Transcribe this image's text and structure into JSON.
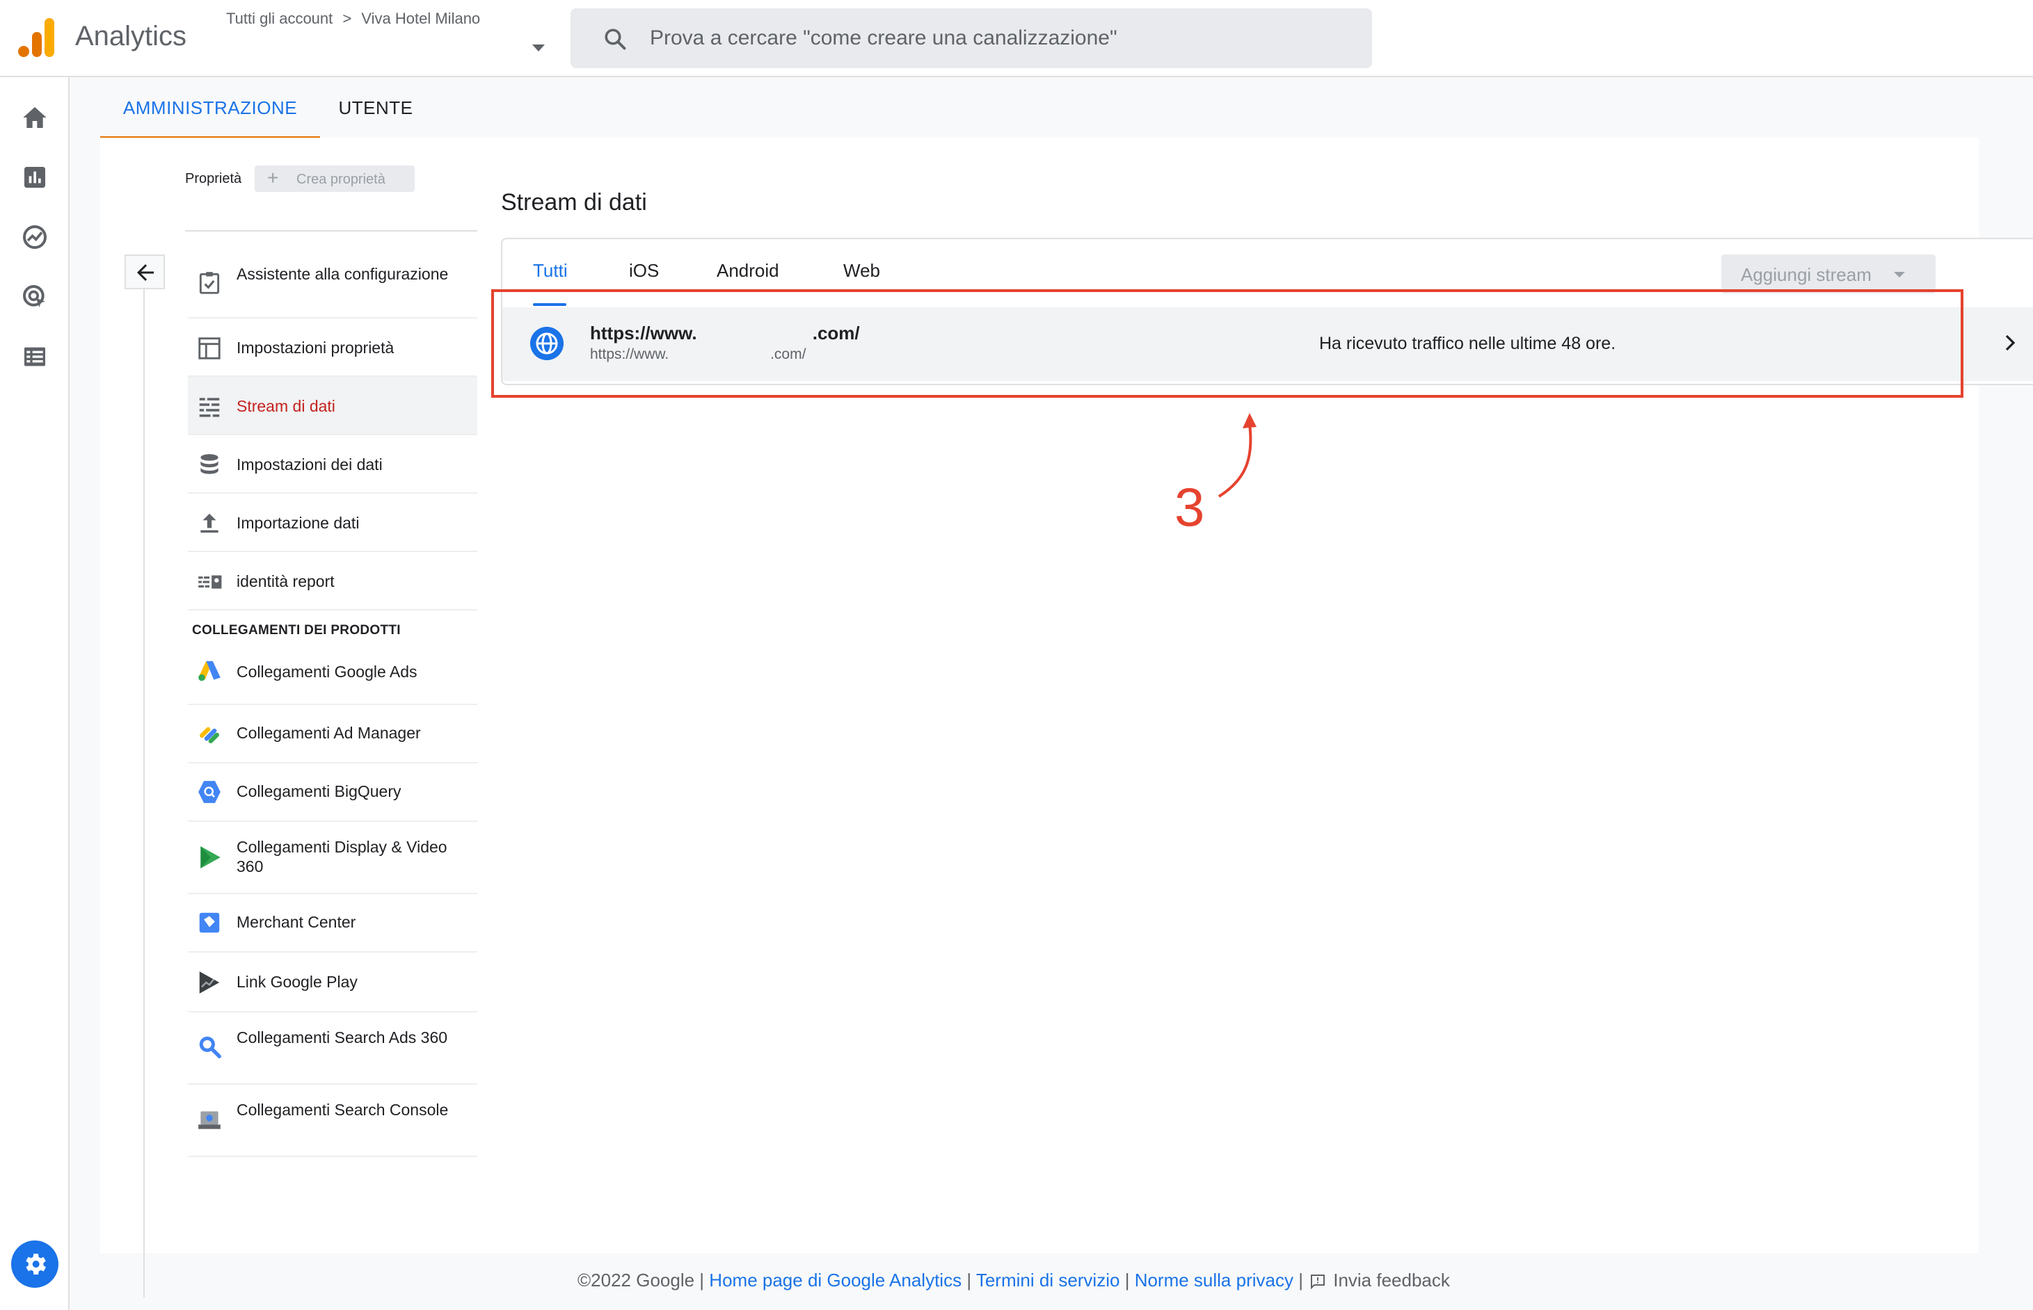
{
  "header": {
    "app_title": "Analytics",
    "breadcrumb_account": "Tutti gli account",
    "breadcrumb_sep": ">",
    "breadcrumb_property": "Viva Hotel Milano",
    "search_placeholder": "Prova a cercare \"come creare una canalizzazione\""
  },
  "admin_tabs": [
    {
      "label": "AMMINISTRAZIONE",
      "active": true
    },
    {
      "label": "UTENTE",
      "active": false
    }
  ],
  "property": {
    "label": "Proprietà",
    "create_label": "Crea proprietà"
  },
  "menu": {
    "items": [
      {
        "label": "Assistente alla configurazione",
        "icon": "checklist-icon"
      },
      {
        "label": "Impostazioni proprietà",
        "icon": "layout-icon"
      },
      {
        "label": "Stream di dati",
        "icon": "streams-icon",
        "active": true
      },
      {
        "label": "Impostazioni dei dati",
        "icon": "database-icon"
      },
      {
        "label": "Importazione dati",
        "icon": "upload-icon"
      },
      {
        "label": "identità report",
        "icon": "identity-icon"
      }
    ],
    "section_title": "COLLEGAMENTI DEI PRODOTTI",
    "product_links": [
      {
        "label": "Collegamenti Google Ads",
        "icon": "google-ads-icon"
      },
      {
        "label": "Collegamenti Ad Manager",
        "icon": "ad-manager-icon"
      },
      {
        "label": "Collegamenti BigQuery",
        "icon": "bigquery-icon"
      },
      {
        "label": "Collegamenti Display & Video 360",
        "icon": "dv360-icon"
      },
      {
        "label": "Merchant Center",
        "icon": "merchant-center-icon"
      },
      {
        "label": "Link Google Play",
        "icon": "google-play-icon"
      },
      {
        "label": "Collegamenti Search Ads 360",
        "icon": "search-ads-icon"
      },
      {
        "label": "Collegamenti Search Console",
        "icon": "search-console-icon"
      }
    ]
  },
  "streams": {
    "title": "Stream di dati",
    "tabs": [
      "Tutti",
      "iOS",
      "Android",
      "Web"
    ],
    "active_tab": "Tutti",
    "add_button": "Aggiungi stream",
    "row": {
      "url_main": "https://www.                       .com/",
      "url_sub": "https://www.                         .com/",
      "status": "Ha ricevuto traffico nelle ultime 48 ore."
    }
  },
  "annotation": {
    "number": "3"
  },
  "footer": {
    "copyright": "©2022 Google",
    "sep": "|",
    "links": [
      "Home page di Google Analytics",
      "Termini di servizio",
      "Norme sulla privacy"
    ],
    "feedback": "Invia feedback"
  },
  "colors": {
    "accent": "#1a73e8",
    "tab_underline": "#e37400",
    "active_menu": "#c5221f",
    "annotation": "#e5432f"
  }
}
